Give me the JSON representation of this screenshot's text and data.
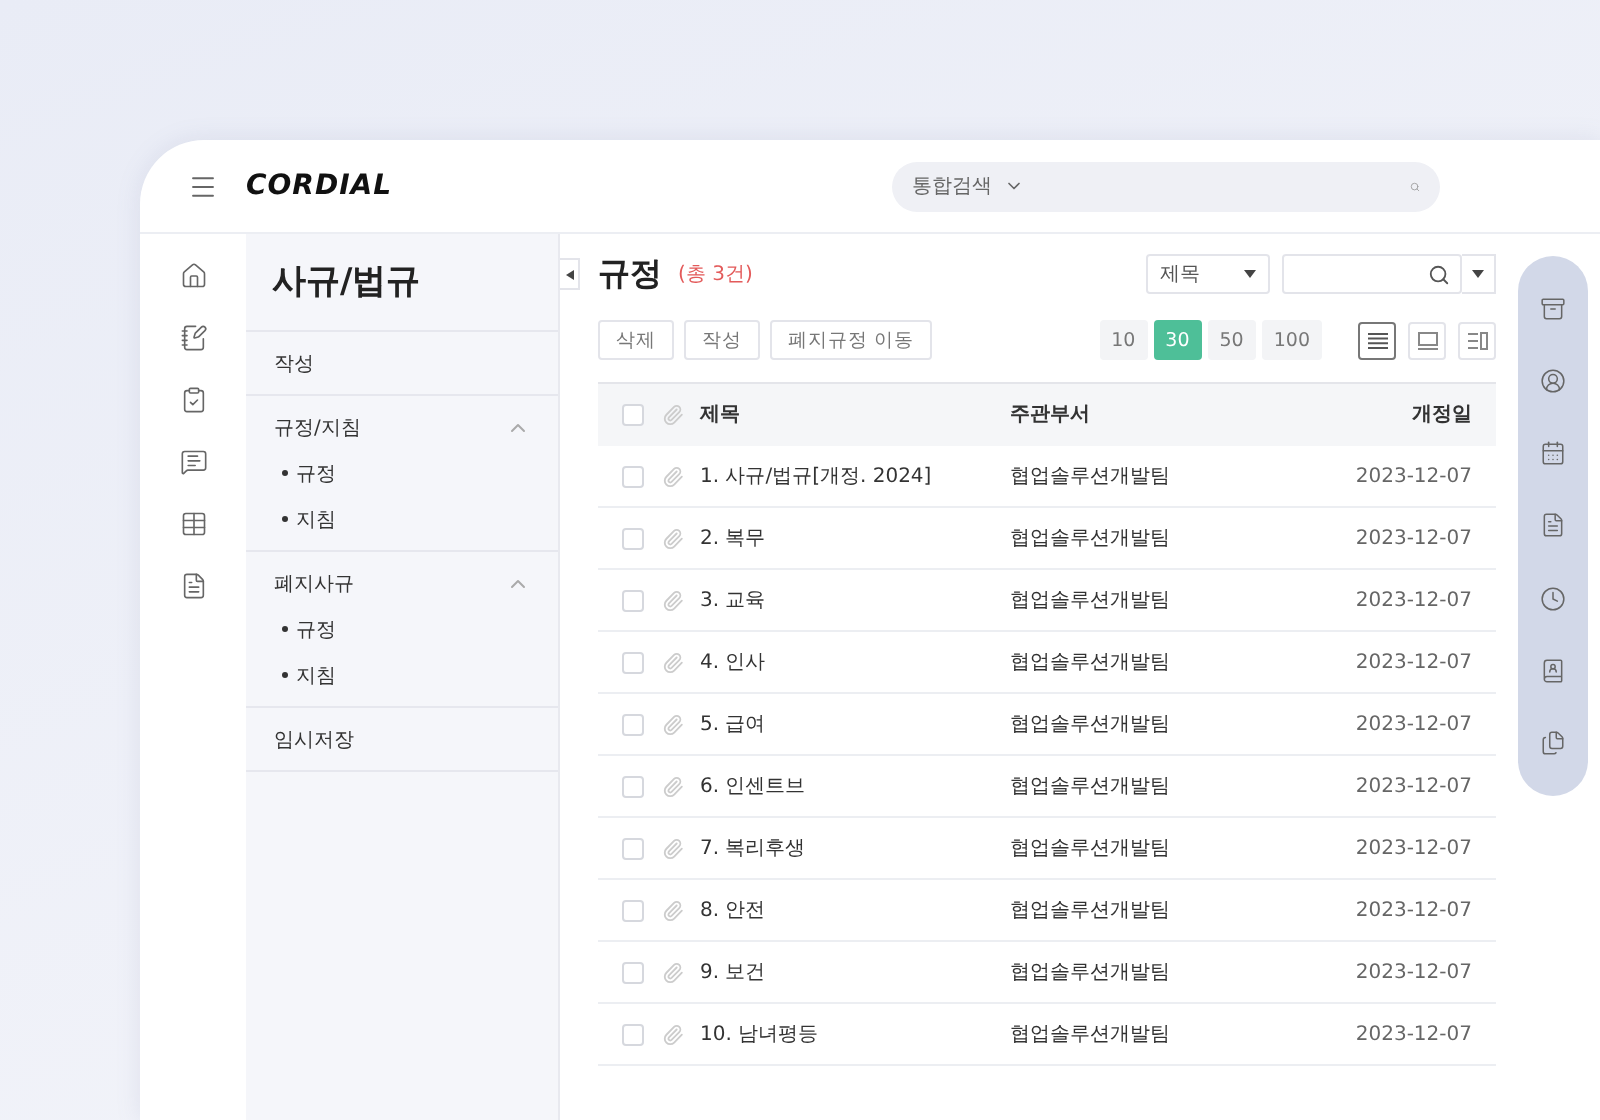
{
  "header": {
    "logo": "CORDIAL",
    "search": {
      "scope": "통합검색"
    }
  },
  "sidebar": {
    "title": "사규/법규",
    "items": [
      {
        "label": "작성"
      },
      {
        "label": "규정/지침",
        "expanded": true,
        "children": [
          {
            "label": "규정"
          },
          {
            "label": "지침"
          }
        ]
      },
      {
        "label": "폐지사규",
        "expanded": true,
        "children": [
          {
            "label": "규정"
          },
          {
            "label": "지침"
          }
        ]
      },
      {
        "label": "임시저장"
      }
    ]
  },
  "main": {
    "title": "규정",
    "count": "(총 3건)",
    "filter_select": "제목",
    "actions": [
      "삭제",
      "작성",
      "폐지규정 이동"
    ],
    "page_sizes": [
      {
        "label": "10",
        "selected": false
      },
      {
        "label": "30",
        "selected": true
      },
      {
        "label": "50",
        "selected": false
      },
      {
        "label": "100",
        "selected": false
      }
    ],
    "view_modes": [
      {
        "kind": "list",
        "selected": true
      },
      {
        "kind": "card",
        "selected": false
      },
      {
        "kind": "split",
        "selected": false
      }
    ],
    "table": {
      "columns": [
        "제목",
        "주관부서",
        "개정일"
      ],
      "all_checked": false,
      "rows": [
        {
          "title": "1. 사규/법규[개정. 2024]",
          "department": "협업솔루션개발팀",
          "date": "2023-12-07",
          "checked": false
        },
        {
          "title": "2. 복무",
          "department": "협업솔루션개발팀",
          "date": "2023-12-07",
          "checked": false
        },
        {
          "title": "3. 교육",
          "department": "협업솔루션개발팀",
          "date": "2023-12-07",
          "checked": false
        },
        {
          "title": "4. 인사",
          "department": "협업솔루션개발팀",
          "date": "2023-12-07",
          "checked": false
        },
        {
          "title": "5. 급여",
          "department": "협업솔루션개발팀",
          "date": "2023-12-07",
          "checked": false
        },
        {
          "title": "6. 인센트브",
          "department": "협업솔루션개발팀",
          "date": "2023-12-07",
          "checked": false
        },
        {
          "title": "7. 복리후생",
          "department": "협업솔루션개발팀",
          "date": "2023-12-07",
          "checked": false
        },
        {
          "title": "8. 안전",
          "department": "협업솔루션개발팀",
          "date": "2023-12-07",
          "checked": false
        },
        {
          "title": "9. 보건",
          "department": "협업솔루션개발팀",
          "date": "2023-12-07",
          "checked": false
        },
        {
          "title": "10. 남녀평등",
          "department": "협업솔루션개발팀",
          "date": "2023-12-07",
          "checked": false
        }
      ]
    }
  }
}
